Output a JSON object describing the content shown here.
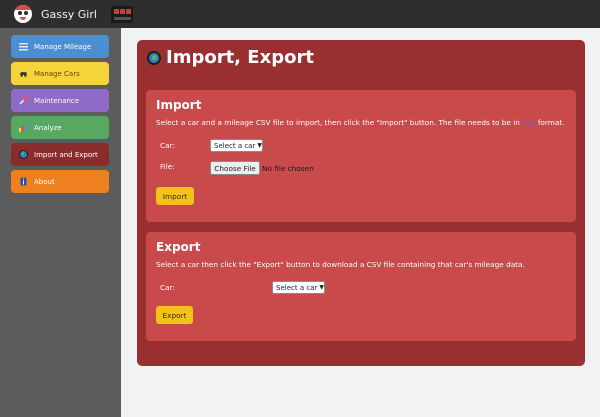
{
  "app": {
    "title": "Gassy Girl",
    "logo_icon": "clown-face-icon",
    "badge_icon": "garage-icon"
  },
  "sidebar": {
    "items": [
      {
        "label": "Manage Mileage",
        "icon": "list-icon",
        "color": "#4a8fd2",
        "active": false
      },
      {
        "label": "Manage Cars",
        "icon": "car-icon",
        "color": "#f5d43b",
        "active": false
      },
      {
        "label": "Maintenance",
        "icon": "wrench-icon",
        "color": "#8d6bc6",
        "active": false
      },
      {
        "label": "Analyze",
        "icon": "chart-icon",
        "color": "#58a862",
        "active": false
      },
      {
        "label": "Import and Export",
        "icon": "globe-icon",
        "color": "#8a2c2c",
        "active": true
      },
      {
        "label": "About",
        "icon": "info-icon",
        "color": "#ee801f",
        "active": false
      }
    ]
  },
  "page": {
    "title": "Import, Export",
    "title_icon": "globe-icon"
  },
  "import": {
    "heading": "Import",
    "desc_before": "Select a car and a mileage CSV file to import, then click the \"Import\" button. The file needs to be in ",
    "desc_link": "this",
    "desc_after": " format.",
    "car_label": "Car:",
    "car_select": "Select a car",
    "file_label": "File:",
    "file_button": "Choose File",
    "file_status": "No file chosen",
    "button": "Import"
  },
  "export": {
    "heading": "Export",
    "desc": "Select a car then click the \"Export\" button to download a CSV file containing that car's mileage data.",
    "car_label": "Car:",
    "car_select": "Select a car",
    "button": "Export"
  },
  "colors": {
    "topbar": "#2e2e2e",
    "sidebar": "#5c5c5c",
    "panel": "#992f30",
    "card": "#c84a4b",
    "button": "#f2c21b",
    "link": "#6a5fd6"
  }
}
